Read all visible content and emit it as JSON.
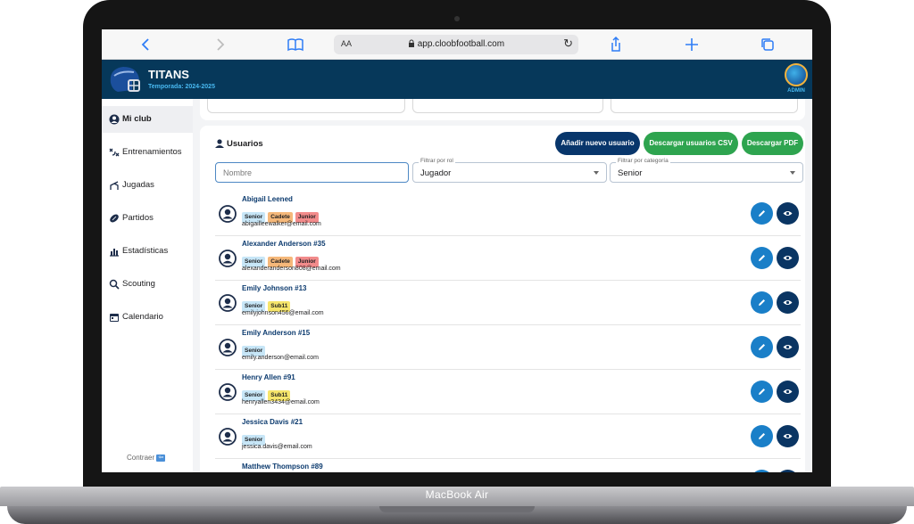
{
  "device": {
    "brand_label": "MacBook Air"
  },
  "browser": {
    "url": "app.cloobfootball.com",
    "text_size_label": "AA",
    "icons": [
      "chevron-left-icon",
      "chevron-right-icon",
      "book-icon",
      "lock-icon",
      "reload-icon",
      "share-icon",
      "plus-icon",
      "tabs-icon"
    ]
  },
  "header": {
    "team_name": "TITANS",
    "season": "Temporada: 2024-2025",
    "user_role": "ADMIN"
  },
  "sidebar": {
    "items": [
      {
        "label": "Mi club",
        "icon": "user-circle-icon",
        "active": true
      },
      {
        "label": "Entrenamientos",
        "icon": "training-icon",
        "active": false
      },
      {
        "label": "Jugadas",
        "icon": "plays-icon",
        "active": false
      },
      {
        "label": "Partidos",
        "icon": "football-icon",
        "active": false
      },
      {
        "label": "Estadísticas",
        "icon": "bar-chart-icon",
        "active": false
      },
      {
        "label": "Scouting",
        "icon": "search-icon",
        "active": false
      },
      {
        "label": "Calendario",
        "icon": "calendar-icon",
        "active": false
      }
    ],
    "collapse_label": "Contraer"
  },
  "users_panel": {
    "title": "Usuarios",
    "buttons": {
      "add": "Añadir nuevo usuario",
      "csv": "Descargar usuarios CSV",
      "pdf": "Descargar PDF"
    },
    "filters": {
      "name_placeholder": "Nombre",
      "role_label": "Filtrar por rol",
      "role_value": "Jugador",
      "category_label": "Filtrar por categoría",
      "category_value": "Senior"
    },
    "users": [
      {
        "name": "Abigail Leened",
        "tags": [
          "Senior",
          "Cadete",
          "Junior"
        ],
        "email": "abigailleewalker@email.com"
      },
      {
        "name": "Alexander Anderson #35",
        "tags": [
          "Senior",
          "Cadete",
          "Junior"
        ],
        "email": "alexanderanderson808@email.com"
      },
      {
        "name": "Emily Johnson #13",
        "tags": [
          "Senior",
          "Sub11"
        ],
        "email": "emilyjohnson456@email.com"
      },
      {
        "name": "Emily Anderson #15",
        "tags": [
          "Senior"
        ],
        "email": "emily.anderson@email.com"
      },
      {
        "name": "Henry Allen #91",
        "tags": [
          "Senior",
          "Sub11"
        ],
        "email": "henryallen3434@email.com"
      },
      {
        "name": "Jessica Davis #21",
        "tags": [
          "Senior"
        ],
        "email": "jessica.davis@email.com"
      },
      {
        "name": "Matthew Thompson #89",
        "tags": [],
        "email": ""
      }
    ]
  },
  "colors": {
    "header_bg": "#06385a",
    "accent_blue": "#1a7fc8",
    "navy": "#0a3563",
    "green": "#2ea44f",
    "season_text": "#48b8f0"
  }
}
